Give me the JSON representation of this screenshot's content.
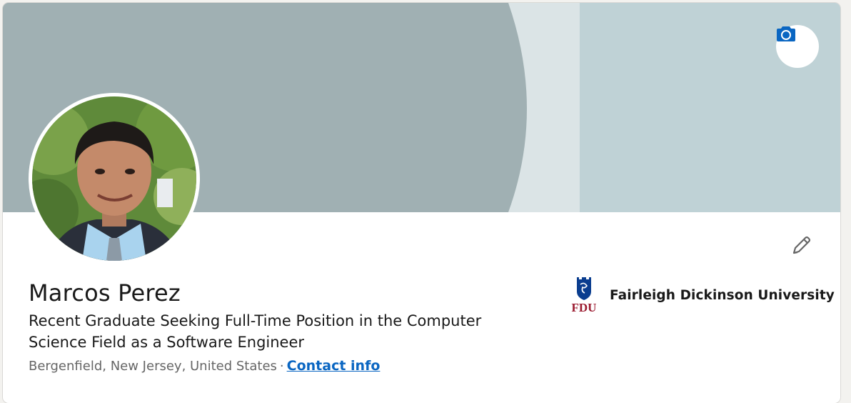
{
  "profile": {
    "name": "Marcos Perez",
    "headline": "Recent Graduate Seeking Full-Time Position in the Computer Science Field as a Software Engineer",
    "location": "Bergenfield, New Jersey, United States",
    "separator": "·",
    "contact_info_label": "Contact info"
  },
  "education": {
    "school_name": "Fairleigh Dickinson University",
    "logo_text": "FDU"
  },
  "icons": {
    "banner_camera": "camera-icon",
    "edit": "pencil-icon",
    "school_logo": "fdu-logo"
  },
  "colors": {
    "banner_dark": "#a0b0b3",
    "banner_light": "#bfd2d6",
    "banner_strip": "#dbe4e6",
    "link": "#0a66c2",
    "fdu_red": "#9b1b30",
    "fdu_blue": "#0a3d8f"
  }
}
